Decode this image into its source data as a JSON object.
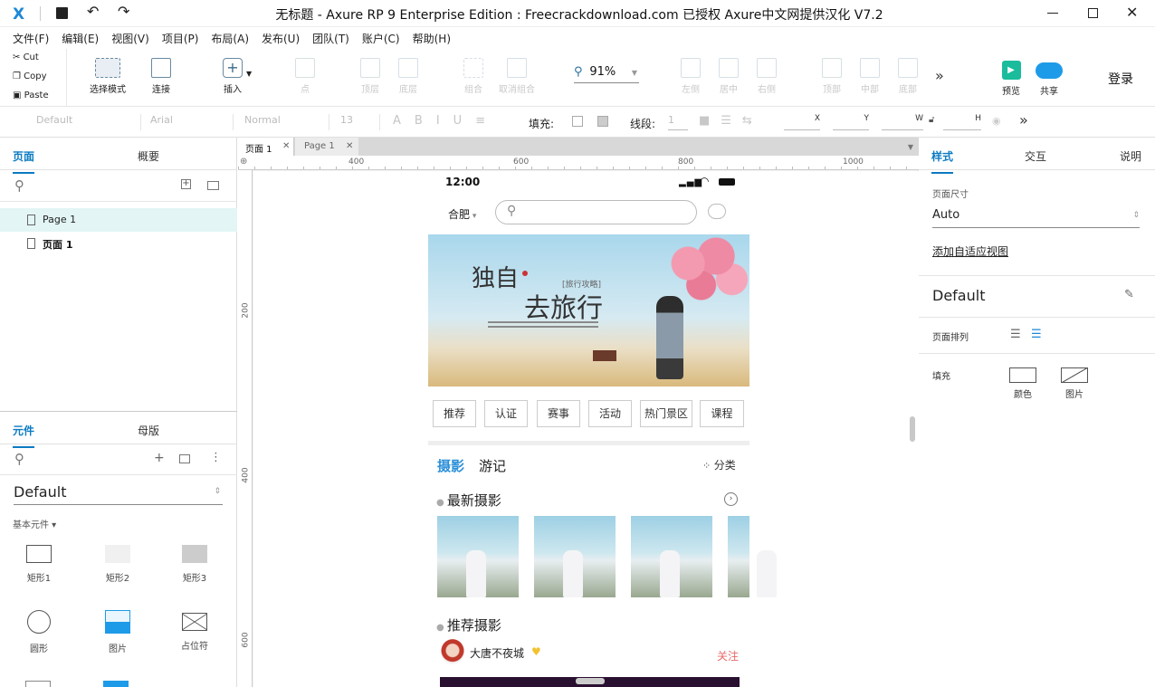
{
  "window": {
    "title": "无标题 - Axure RP 9 Enterprise Edition : Freecrackdownload.com 已授权     Axure中文网提供汉化 V7.2"
  },
  "menu": [
    "文件(F)",
    "编辑(E)",
    "视图(V)",
    "项目(P)",
    "布局(A)",
    "发布(U)",
    "团队(T)",
    "账户(C)",
    "帮助(H)"
  ],
  "clipboard": {
    "cut": "Cut",
    "copy": "Copy",
    "paste": "Paste"
  },
  "toolbar": {
    "select": "选择模式",
    "connect": "连接",
    "insert": "插入",
    "point": "点",
    "top_layer": "顶层",
    "bottom_layer": "底层",
    "group": "组合",
    "ungroup": "取消组合",
    "zoom": "91%",
    "align_left": "左侧",
    "align_center": "居中",
    "align_right": "右侧",
    "align_top": "顶部",
    "align_middle": "中部",
    "align_bottom": "底部",
    "preview": "预览",
    "share": "共享",
    "login": "登录"
  },
  "format": {
    "style": "Default",
    "font": "Arial",
    "weight": "Normal",
    "size": "13",
    "fill_label": "填充:",
    "line_label": "线段:",
    "line_value": "1",
    "x": "X",
    "y": "Y",
    "w": "W",
    "h": "H"
  },
  "left_top": {
    "tab_pages": "页面",
    "tab_outline": "概要",
    "pages": [
      "Page 1",
      "页面 1"
    ]
  },
  "left_bottom": {
    "tab_widgets": "元件",
    "tab_masters": "母版",
    "library": "Default",
    "category": "基本元件 ▾",
    "widgets": [
      "矩形1",
      "矩形2",
      "矩形3",
      "圆形",
      "图片",
      "占位符"
    ]
  },
  "canvas": {
    "tabs": [
      "页面 1",
      "Page 1"
    ],
    "ruler_h": [
      "400",
      "600",
      "800",
      "1000"
    ],
    "ruler_v": [
      "200",
      "400",
      "600"
    ]
  },
  "phone": {
    "time": "12:00",
    "city": "合肥",
    "banner_title_1": "独自",
    "banner_title_2": "去旅行",
    "banner_tag": "[旅行攻略]",
    "tags": [
      "推荐",
      "认证",
      "赛事",
      "活动",
      "热门景区",
      "课程"
    ],
    "tab_photo": "摄影",
    "tab_travel": "游记",
    "category": "分类",
    "latest": "最新摄影",
    "recommend": "推荐摄影",
    "user": "大唐不夜城",
    "follow": "关注"
  },
  "right": {
    "tab_style": "样式",
    "tab_interact": "交互",
    "tab_notes": "说明",
    "page_size_label": "页面尺寸",
    "page_size": "Auto",
    "adaptive_link": "添加自适应视图",
    "style_name": "Default",
    "page_align": "页面排列",
    "fill": "填充",
    "fill_color": "颜色",
    "fill_image": "图片"
  },
  "colors": {
    "accent": "#0c7bc2",
    "teal": "#1abc9c",
    "cloud": "#1e9be8",
    "follow": "#e86a6a"
  }
}
